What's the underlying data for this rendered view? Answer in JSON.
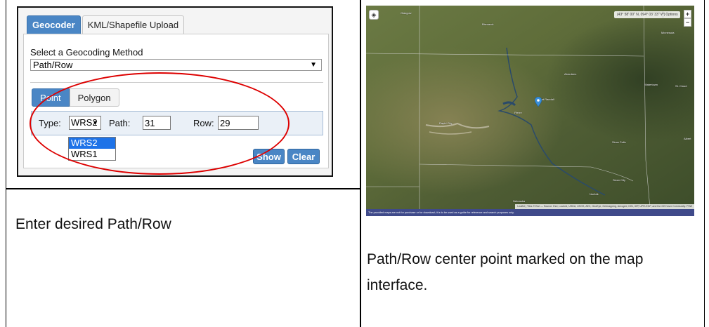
{
  "left_caption": "Enter desired Path/Row",
  "right_caption": "Path/Row center point marked on the map interface.",
  "geocoder": {
    "tabs": [
      "Geocoder",
      "KML/Shapefile Upload"
    ],
    "select_label": "Select a Geocoding Method",
    "method_value": "Path/Row",
    "subtabs": [
      "Point",
      "Polygon"
    ],
    "type_label": "Type:",
    "type_value": "WRS2",
    "type_options": [
      "WRS2",
      "WRS1"
    ],
    "path_label": "Path:",
    "path_value": "31",
    "row_label": "Row:",
    "row_value": "29",
    "show_button": "Show",
    "clear_button": "Clear",
    "highlight_color": "#dd0000",
    "accent_color": "#4a86c5"
  },
  "map": {
    "zoom_in": "+",
    "zoom_out": "−",
    "coordinates": "(43° 58' 00\" N, 094° 03' 33\" W)",
    "options_label": "Options",
    "cities": [
      "Bismarck",
      "Minnesota",
      "St. Cloud",
      "Aberdeen",
      "Pierre",
      "Rapid City",
      "Sioux Falls",
      "Sioux City",
      "Norfolk",
      "Nebraska",
      "Fort Randall",
      "Watertown",
      "Albert",
      "Glasgow"
    ],
    "attribution": "Leaflet | Tiles © Esri — Source: Esri, i-cubed, USDA, USGS, AEX, GeoEye, Getmapping, Aerogrid, IGN, IGP, UPR-EGP, and the GIS User Community. FSW",
    "footer_text": "The provided maps are not for purchase or for download; it is to be used as a guide for reference and search purposes only.",
    "marker_icon": "map-marker-icon",
    "layers_icon": "layers-icon"
  }
}
